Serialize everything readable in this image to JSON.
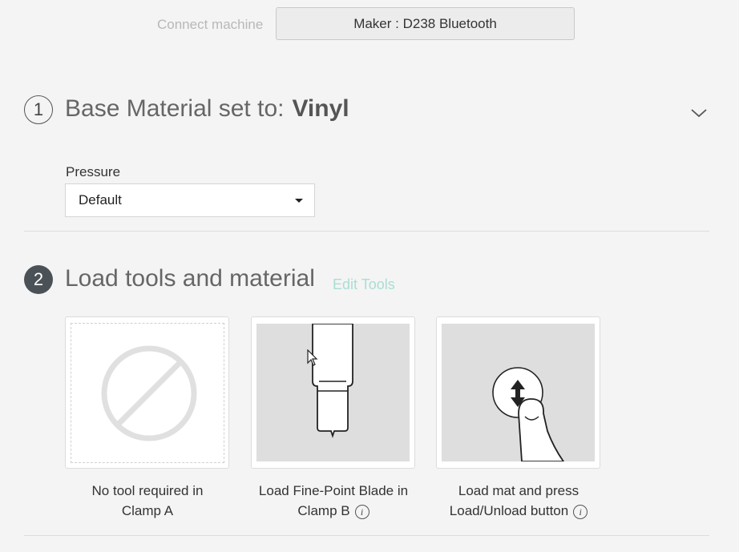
{
  "connect": {
    "label": "Connect machine",
    "machine": "Maker : D238 Bluetooth"
  },
  "step1": {
    "number": "1",
    "title": "Base Material set to:",
    "material": "Vinyl",
    "pressure_label": "Pressure",
    "pressure_value": "Default"
  },
  "step2": {
    "number": "2",
    "title": "Load tools and material",
    "edit_tools": "Edit Tools",
    "cards": [
      {
        "line1": "No tool required in",
        "line2": "Clamp A",
        "icon": "no-tool-icon"
      },
      {
        "line1": "Load Fine-Point Blade in",
        "line2": "Clamp B",
        "icon": "fine-point-blade-icon"
      },
      {
        "line1": "Load mat and press",
        "line2": "Load/Unload button",
        "icon": "load-unload-button-icon"
      }
    ],
    "info_glyph": "i"
  },
  "colors": {
    "accent_link": "#a9ded3",
    "step_filled": "#4a5157"
  }
}
